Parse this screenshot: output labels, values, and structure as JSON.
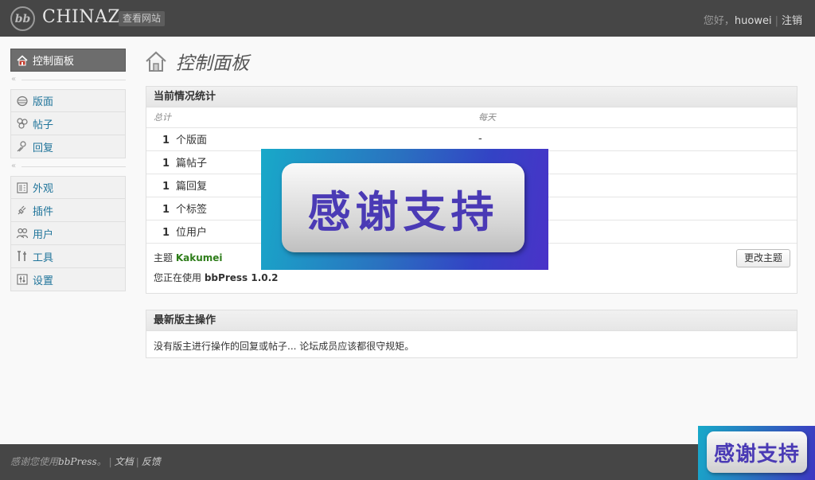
{
  "header": {
    "logo_text": "bb",
    "site_name": "CHINAZ",
    "view_site": "查看网站",
    "greeting": "您好，",
    "username": "huowei",
    "separator": "|",
    "logout": "注销"
  },
  "sidebar": {
    "dashboard": "控制面板",
    "collapse_glyph": "«",
    "group1": [
      {
        "label": "版面",
        "icon": "forum-icon"
      },
      {
        "label": "帖子",
        "icon": "topics-icon"
      },
      {
        "label": "回复",
        "icon": "replies-icon"
      }
    ],
    "group2": [
      {
        "label": "外观",
        "icon": "appearance-icon"
      },
      {
        "label": "插件",
        "icon": "plugins-icon"
      },
      {
        "label": "用户",
        "icon": "users-icon"
      },
      {
        "label": "工具",
        "icon": "tools-icon"
      },
      {
        "label": "设置",
        "icon": "settings-icon"
      }
    ]
  },
  "main": {
    "title": "控制面板",
    "stats": {
      "heading": "当前情况统计",
      "col_total": "总计",
      "col_daily": "每天",
      "rows": [
        {
          "num": "1",
          "label": "个版面",
          "daily": "-"
        },
        {
          "num": "1",
          "label": "篇帖子",
          "daily": ""
        },
        {
          "num": "1",
          "label": "篇回复",
          "daily": ""
        },
        {
          "num": "1",
          "label": "个标签",
          "daily": ""
        },
        {
          "num": "1",
          "label": "位用户",
          "daily": ""
        }
      ],
      "theme_label": "主题",
      "theme_name": "Kakumei",
      "change_theme": "更改主题",
      "using_prefix": "您正在使用",
      "version": "bbPress 1.0.2"
    },
    "moderation": {
      "heading": "最新版主操作",
      "text": "没有版主进行操作的回复或帖子... 论坛成员应该都很守规矩。"
    }
  },
  "overlay": {
    "text": "感谢支持"
  },
  "corner_badge": {
    "text": "感谢支持"
  },
  "footer": {
    "thanks_prefix": "感谢您使用",
    "bbpress": "bbPress",
    "period": "。",
    "pipe": "|",
    "docs": "文档",
    "feedback": "反馈"
  },
  "colors": {
    "header_bg": "#464646",
    "link": "#21759b",
    "theme_green": "#2e7d1a"
  }
}
